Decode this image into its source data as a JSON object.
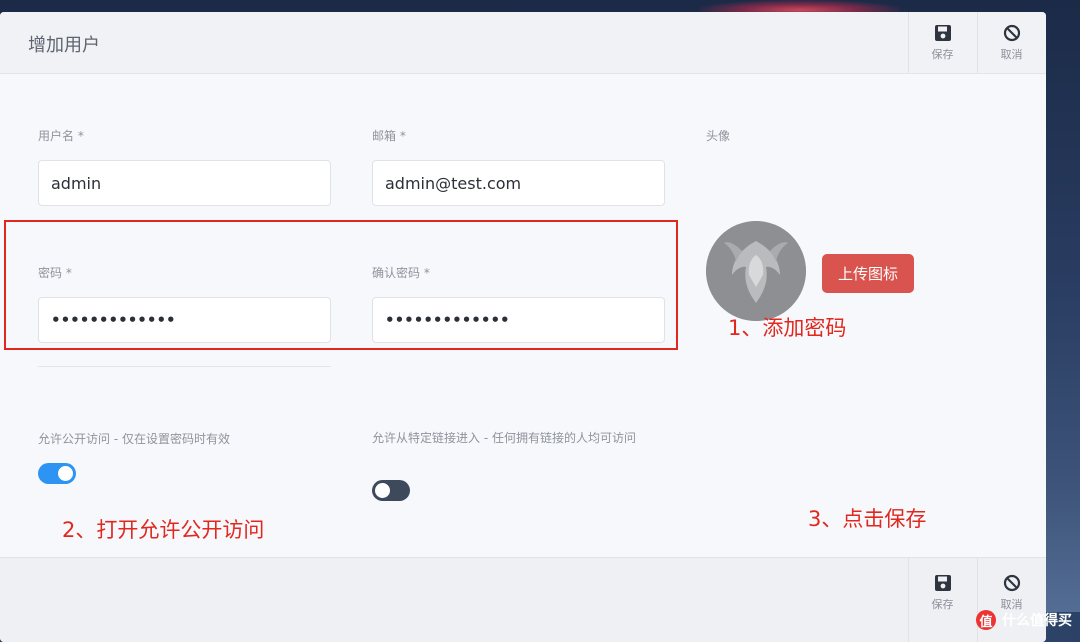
{
  "dialog": {
    "title": "增加用户",
    "save_label": "保存",
    "cancel_label": "取消"
  },
  "form": {
    "username": {
      "label": "用户名 *",
      "value": "admin"
    },
    "email": {
      "label": "邮箱 *",
      "value": "admin@test.com"
    },
    "password": {
      "label": "密码 *",
      "value": "•••••••••••••"
    },
    "confirm_password": {
      "label": "确认密码 *",
      "value": "•••••••••••••"
    },
    "avatar": {
      "label": "头像",
      "upload_label": "上传图标"
    },
    "public_access": {
      "label": "允许公开访问 - 仅在设置密码时有效",
      "on": true
    },
    "link_access": {
      "label": "允许从特定链接进入 - 任何拥有链接的人均可访问",
      "on": false
    }
  },
  "annotations": {
    "step1": "1、添加密码",
    "step2": "2、打开允许公开访问",
    "step3": "3、点击保存"
  },
  "watermark": {
    "icon_text": "值",
    "text": "什么值得买"
  },
  "colors": {
    "accent_red": "#d9534f",
    "annotation_red": "#e0281f",
    "toggle_on": "#2e94f3",
    "toggle_off": "#3e4a5c"
  },
  "icons": {
    "save": "floppy-disk-icon",
    "cancel": "prohibited-circle-icon"
  }
}
